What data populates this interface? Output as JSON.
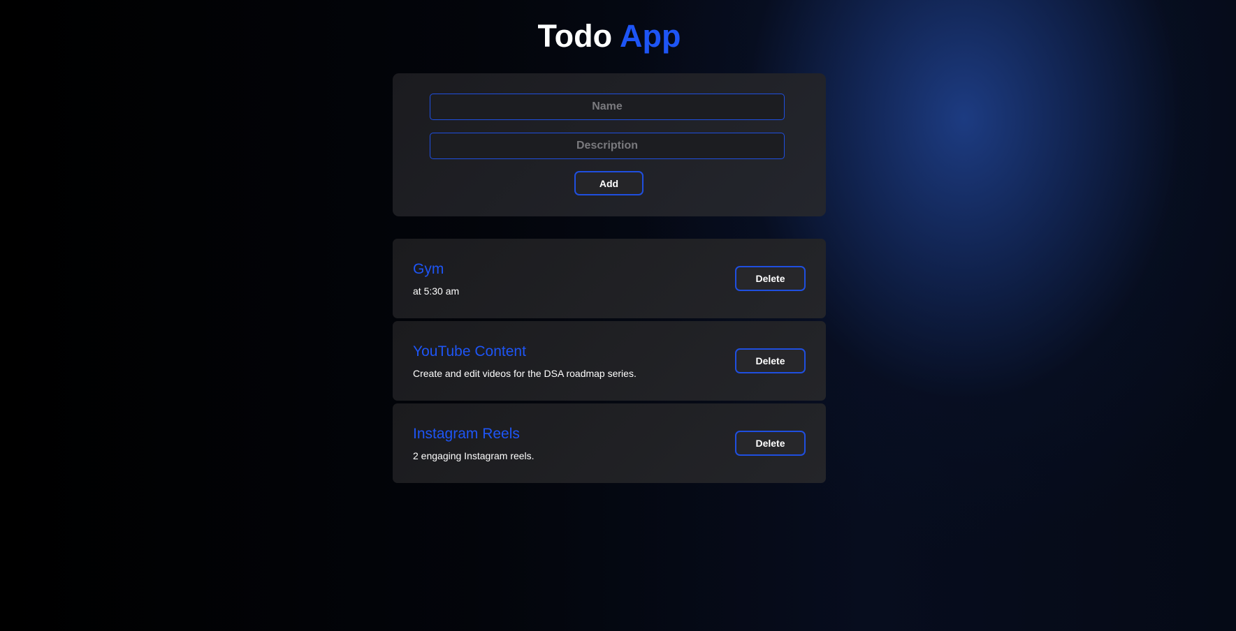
{
  "header": {
    "title_part1": "Todo",
    "title_part2": "App"
  },
  "form": {
    "name_placeholder": "Name",
    "name_value": "",
    "description_placeholder": "Description",
    "description_value": "",
    "add_label": "Add"
  },
  "todos": [
    {
      "name": "Gym",
      "description": "at 5:30 am",
      "delete_label": "Delete"
    },
    {
      "name": "YouTube Content",
      "description": "Create and edit videos for the DSA roadmap series.",
      "delete_label": "Delete"
    },
    {
      "name": "Instagram Reels",
      "description": "2 engaging Instagram reels.",
      "delete_label": "Delete"
    }
  ],
  "colors": {
    "accent": "#1e55f5",
    "card": "#202125",
    "background": "#000000",
    "glow": "#1e3e87"
  }
}
